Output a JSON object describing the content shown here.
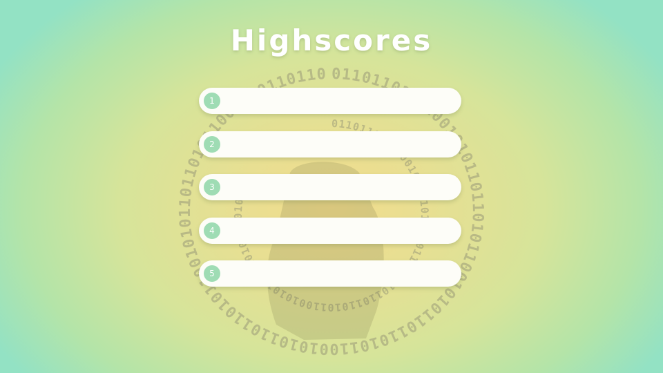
{
  "title": "Highscores",
  "background": {
    "art": "binary-ring-monster-icon",
    "binary_pattern": "0110110101100101",
    "colors": {
      "center": "#f2dc8c",
      "edge": "#93e2c4"
    }
  },
  "badge_color": "#9fdcb4",
  "highscores": [
    {
      "rank": "1",
      "score": ""
    },
    {
      "rank": "2",
      "score": ""
    },
    {
      "rank": "3",
      "score": ""
    },
    {
      "rank": "4",
      "score": ""
    },
    {
      "rank": "5",
      "score": ""
    }
  ]
}
